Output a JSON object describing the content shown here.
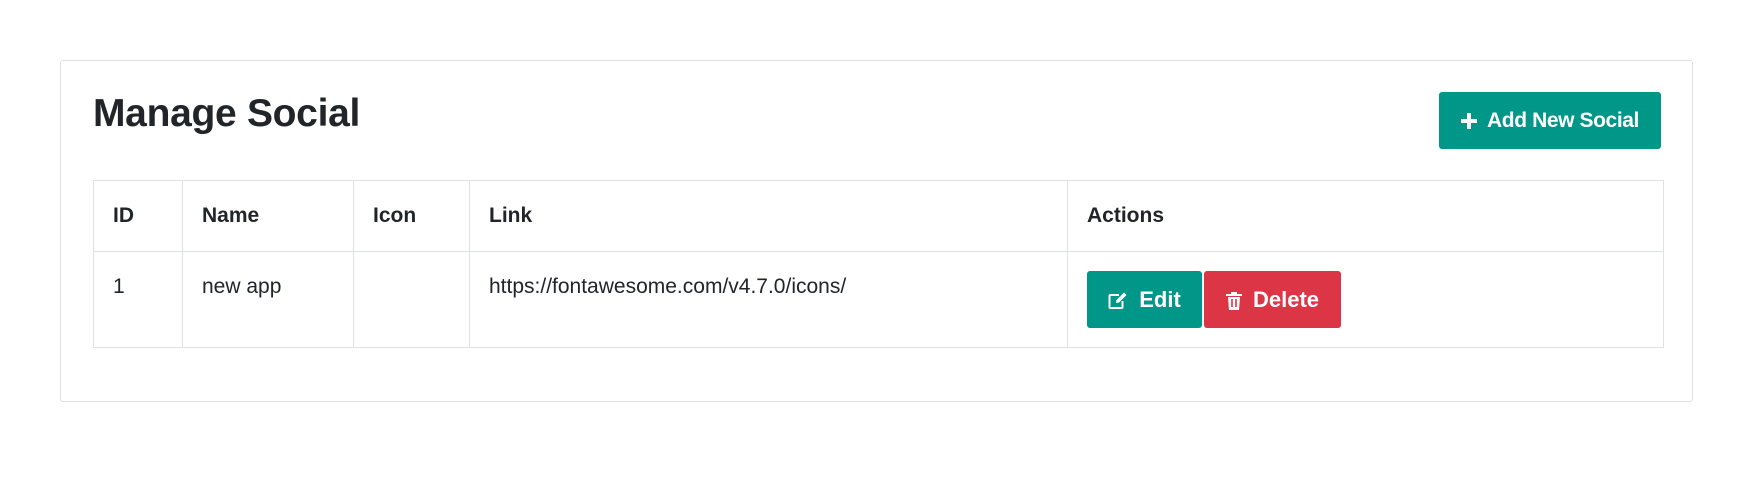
{
  "header": {
    "title": "Manage Social",
    "add_button_label": "Add New Social"
  },
  "table": {
    "columns": [
      "ID",
      "Name",
      "Icon",
      "Link",
      "Actions"
    ],
    "rows": [
      {
        "id": "1",
        "name": "new app",
        "icon": "",
        "link": "https://fontawesome.com/v4.7.0/icons/",
        "edit_label": "Edit",
        "delete_label": "Delete"
      }
    ]
  },
  "colors": {
    "primary": "#009688",
    "danger": "#dc3545",
    "border": "#dee2e6",
    "text": "#212529"
  },
  "icons": {
    "add": "plus-icon",
    "edit": "edit-icon",
    "delete": "trash-icon"
  }
}
